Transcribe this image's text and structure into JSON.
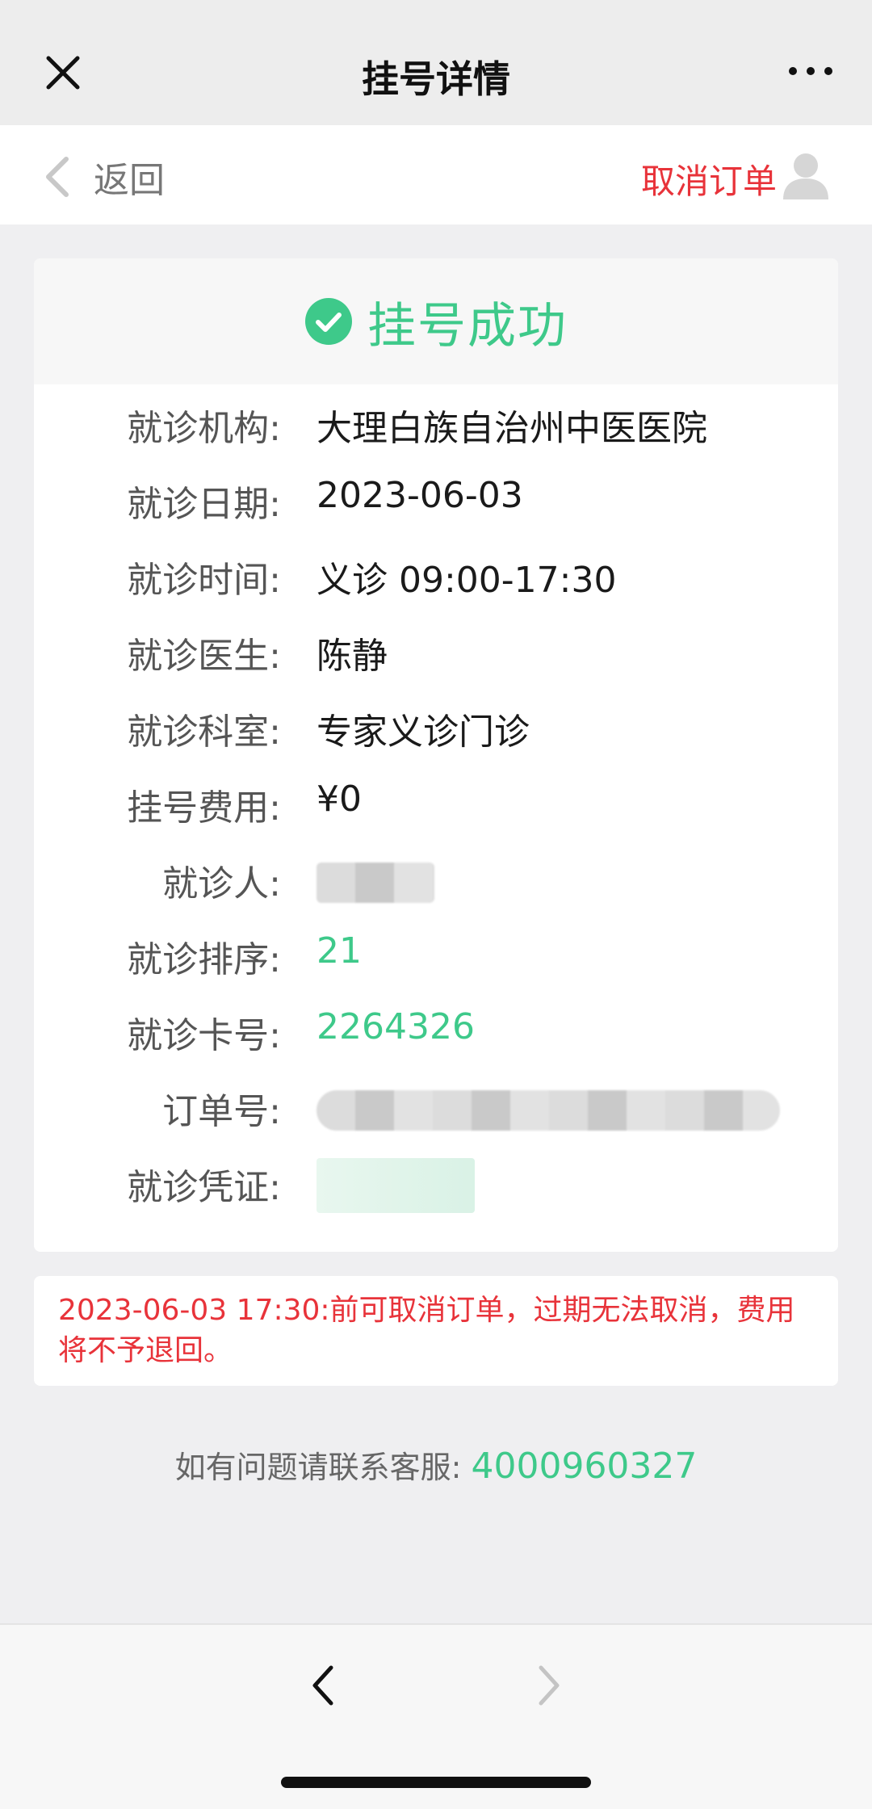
{
  "titlebar": {
    "title": "挂号详情"
  },
  "navbar": {
    "back_label": "返回",
    "cancel_label": "取消订单"
  },
  "card": {
    "status": "挂号成功",
    "rows": [
      {
        "label": "就诊机构:",
        "value": "大理白族自治州中医医院"
      },
      {
        "label": "就诊日期:",
        "value": "2023-06-03"
      },
      {
        "label": "就诊时间:",
        "value": "义诊 09:00-17:30"
      },
      {
        "label": "就诊医生:",
        "value": "陈静"
      },
      {
        "label": "就诊科室:",
        "value": "专家义诊门诊"
      },
      {
        "label": "挂号费用:",
        "value": "¥0"
      },
      {
        "label": "就诊人:",
        "value": ""
      },
      {
        "label": "就诊排序:",
        "value": "21"
      },
      {
        "label": "就诊卡号:",
        "value": "2264326"
      },
      {
        "label": "订单号:",
        "value": ""
      },
      {
        "label": "就诊凭证:",
        "value": ""
      }
    ]
  },
  "notice": "2023-06-03 17:30:前可取消订单，过期无法取消，费用将不予退回。",
  "service": {
    "label": "如有问题请联系客服:",
    "phone": "4000960327"
  },
  "colors": {
    "accent_green": "#3ec98a",
    "alert_red": "#e8333a"
  },
  "icons": [
    "close-icon",
    "more-icon",
    "back-chevron-icon",
    "avatar-icon",
    "success-check-icon",
    "prev-arrow-icon",
    "next-arrow-icon"
  ]
}
